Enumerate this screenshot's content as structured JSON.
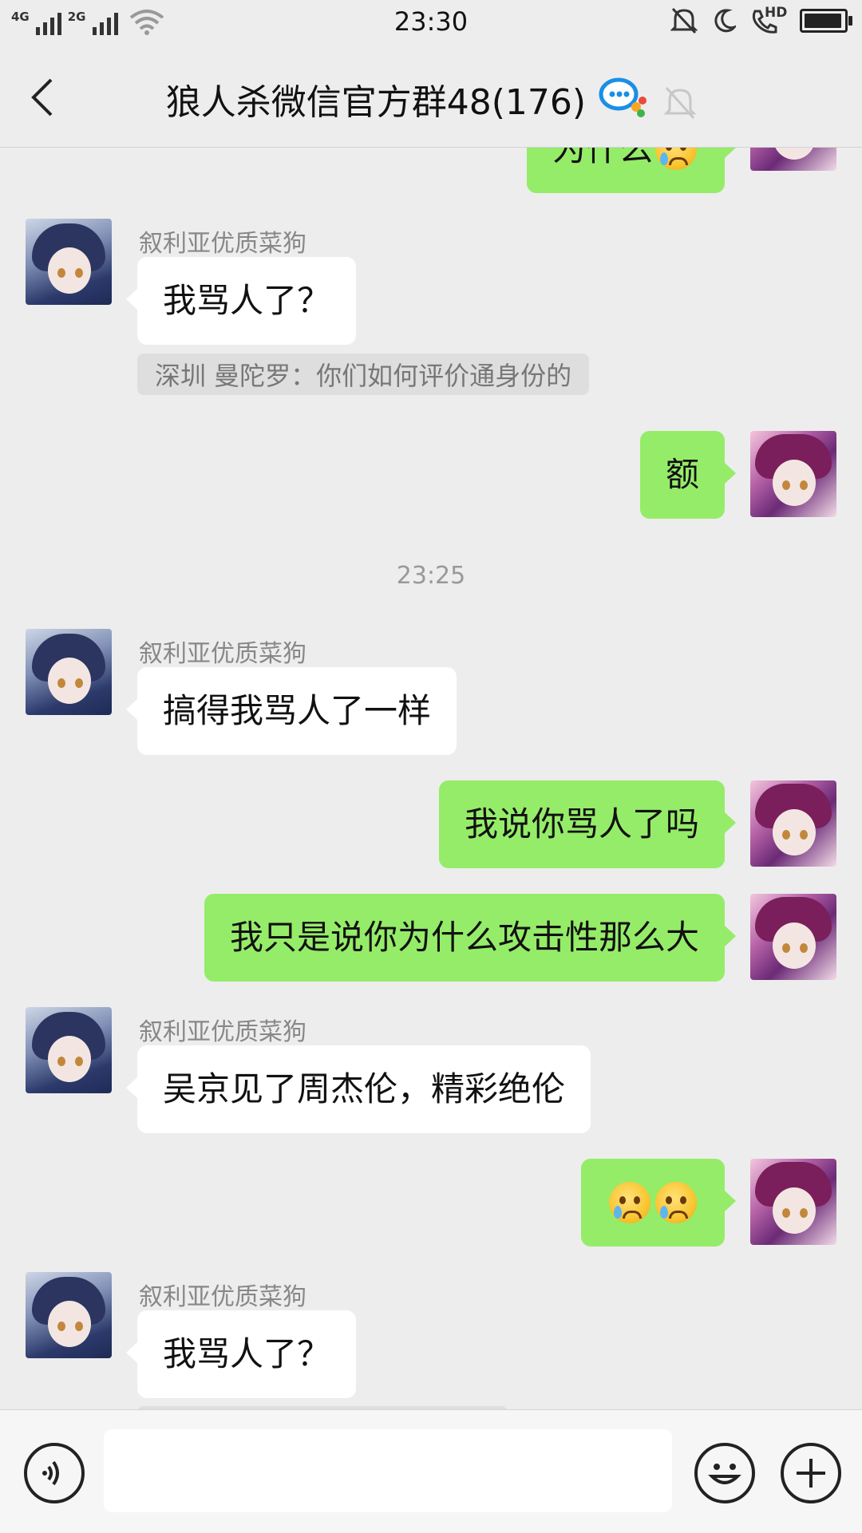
{
  "status_bar": {
    "net1": "4G",
    "net2": "2G",
    "time": "23:30",
    "hd": "HD"
  },
  "header": {
    "title": "狼人杀微信官方群48(176)"
  },
  "messages": {
    "top_partial": "为什么",
    "m1_sender": "叙利亚优质菜狗",
    "m1_text": "我骂人了？",
    "m1_quote": "深圳 曼陀罗：你们如何评价通身份的",
    "m2_text": "额",
    "timestamp": "23:25",
    "m3_sender": "叙利亚优质菜狗",
    "m3_text": "搞得我骂人了一样",
    "m4_text": "我说你骂人了吗",
    "m5_text": "我只是说你为什么攻击性那么大",
    "m6_sender": "叙利亚优质菜狗",
    "m6_text": "吴京见了周杰伦，精彩绝伦",
    "m8_sender": "叙利亚优质菜狗",
    "m8_text": "我骂人了？"
  },
  "icons": {
    "crying_emoji": "crying-face-emoji",
    "voice": "voice-icon",
    "emoji_button": "smiley-icon",
    "more_button": "plus-icon"
  },
  "colors": {
    "outgoing_bubble": "#95ec69",
    "incoming_bubble": "#ffffff",
    "background": "#ededed"
  }
}
